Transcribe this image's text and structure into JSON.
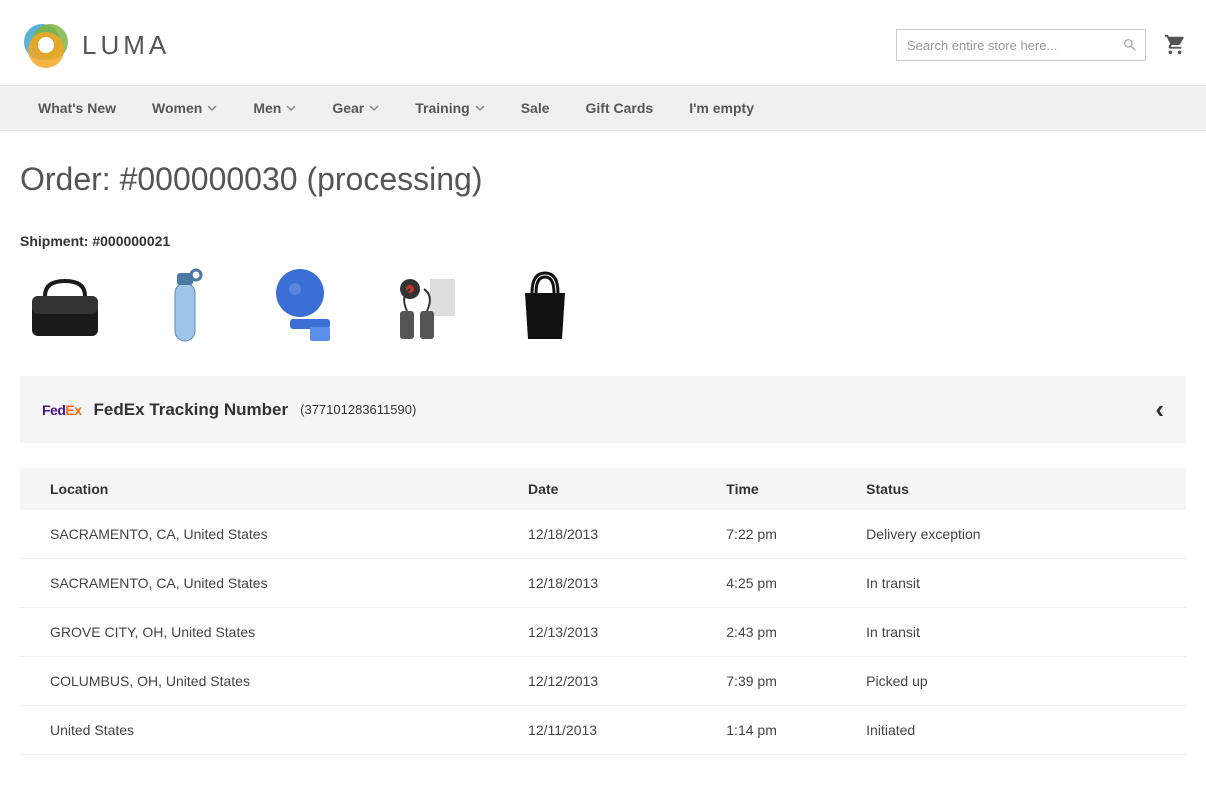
{
  "brand": "LUMA",
  "search": {
    "placeholder": "Search entire store here..."
  },
  "nav": [
    {
      "label": "What's New",
      "dropdown": false
    },
    {
      "label": "Women",
      "dropdown": true
    },
    {
      "label": "Men",
      "dropdown": true
    },
    {
      "label": "Gear",
      "dropdown": true
    },
    {
      "label": "Training",
      "dropdown": true
    },
    {
      "label": "Sale",
      "dropdown": false
    },
    {
      "label": "Gift Cards",
      "dropdown": false
    },
    {
      "label": "I'm empty",
      "dropdown": false
    }
  ],
  "order": {
    "title": "Order: #000000030 (processing)",
    "shipment_label": "Shipment: #000000021"
  },
  "products": [
    {
      "name": "messenger-bag"
    },
    {
      "name": "water-bottle"
    },
    {
      "name": "yoga-kit"
    },
    {
      "name": "accessory-set"
    },
    {
      "name": "tote-bag"
    }
  ],
  "tracking": {
    "carrier_label": "FedEx Tracking Number",
    "number": "(377101283611590)"
  },
  "columns": {
    "location": "Location",
    "date": "Date",
    "time": "Time",
    "status": "Status"
  },
  "events": [
    {
      "location": "SACRAMENTO, CA, United States",
      "date": "12/18/2013",
      "time": "7:22 pm",
      "status": "Delivery exception"
    },
    {
      "location": "SACRAMENTO, CA, United States",
      "date": "12/18/2013",
      "time": "4:25 pm",
      "status": "In transit"
    },
    {
      "location": "GROVE CITY, OH, United States",
      "date": "12/13/2013",
      "time": "2:43 pm",
      "status": "In transit"
    },
    {
      "location": "COLUMBUS, OH, United States",
      "date": "12/12/2013",
      "time": "7:39 pm",
      "status": "Picked up"
    },
    {
      "location": "United States",
      "date": "12/11/2013",
      "time": "1:14 pm",
      "status": "Initiated"
    }
  ]
}
